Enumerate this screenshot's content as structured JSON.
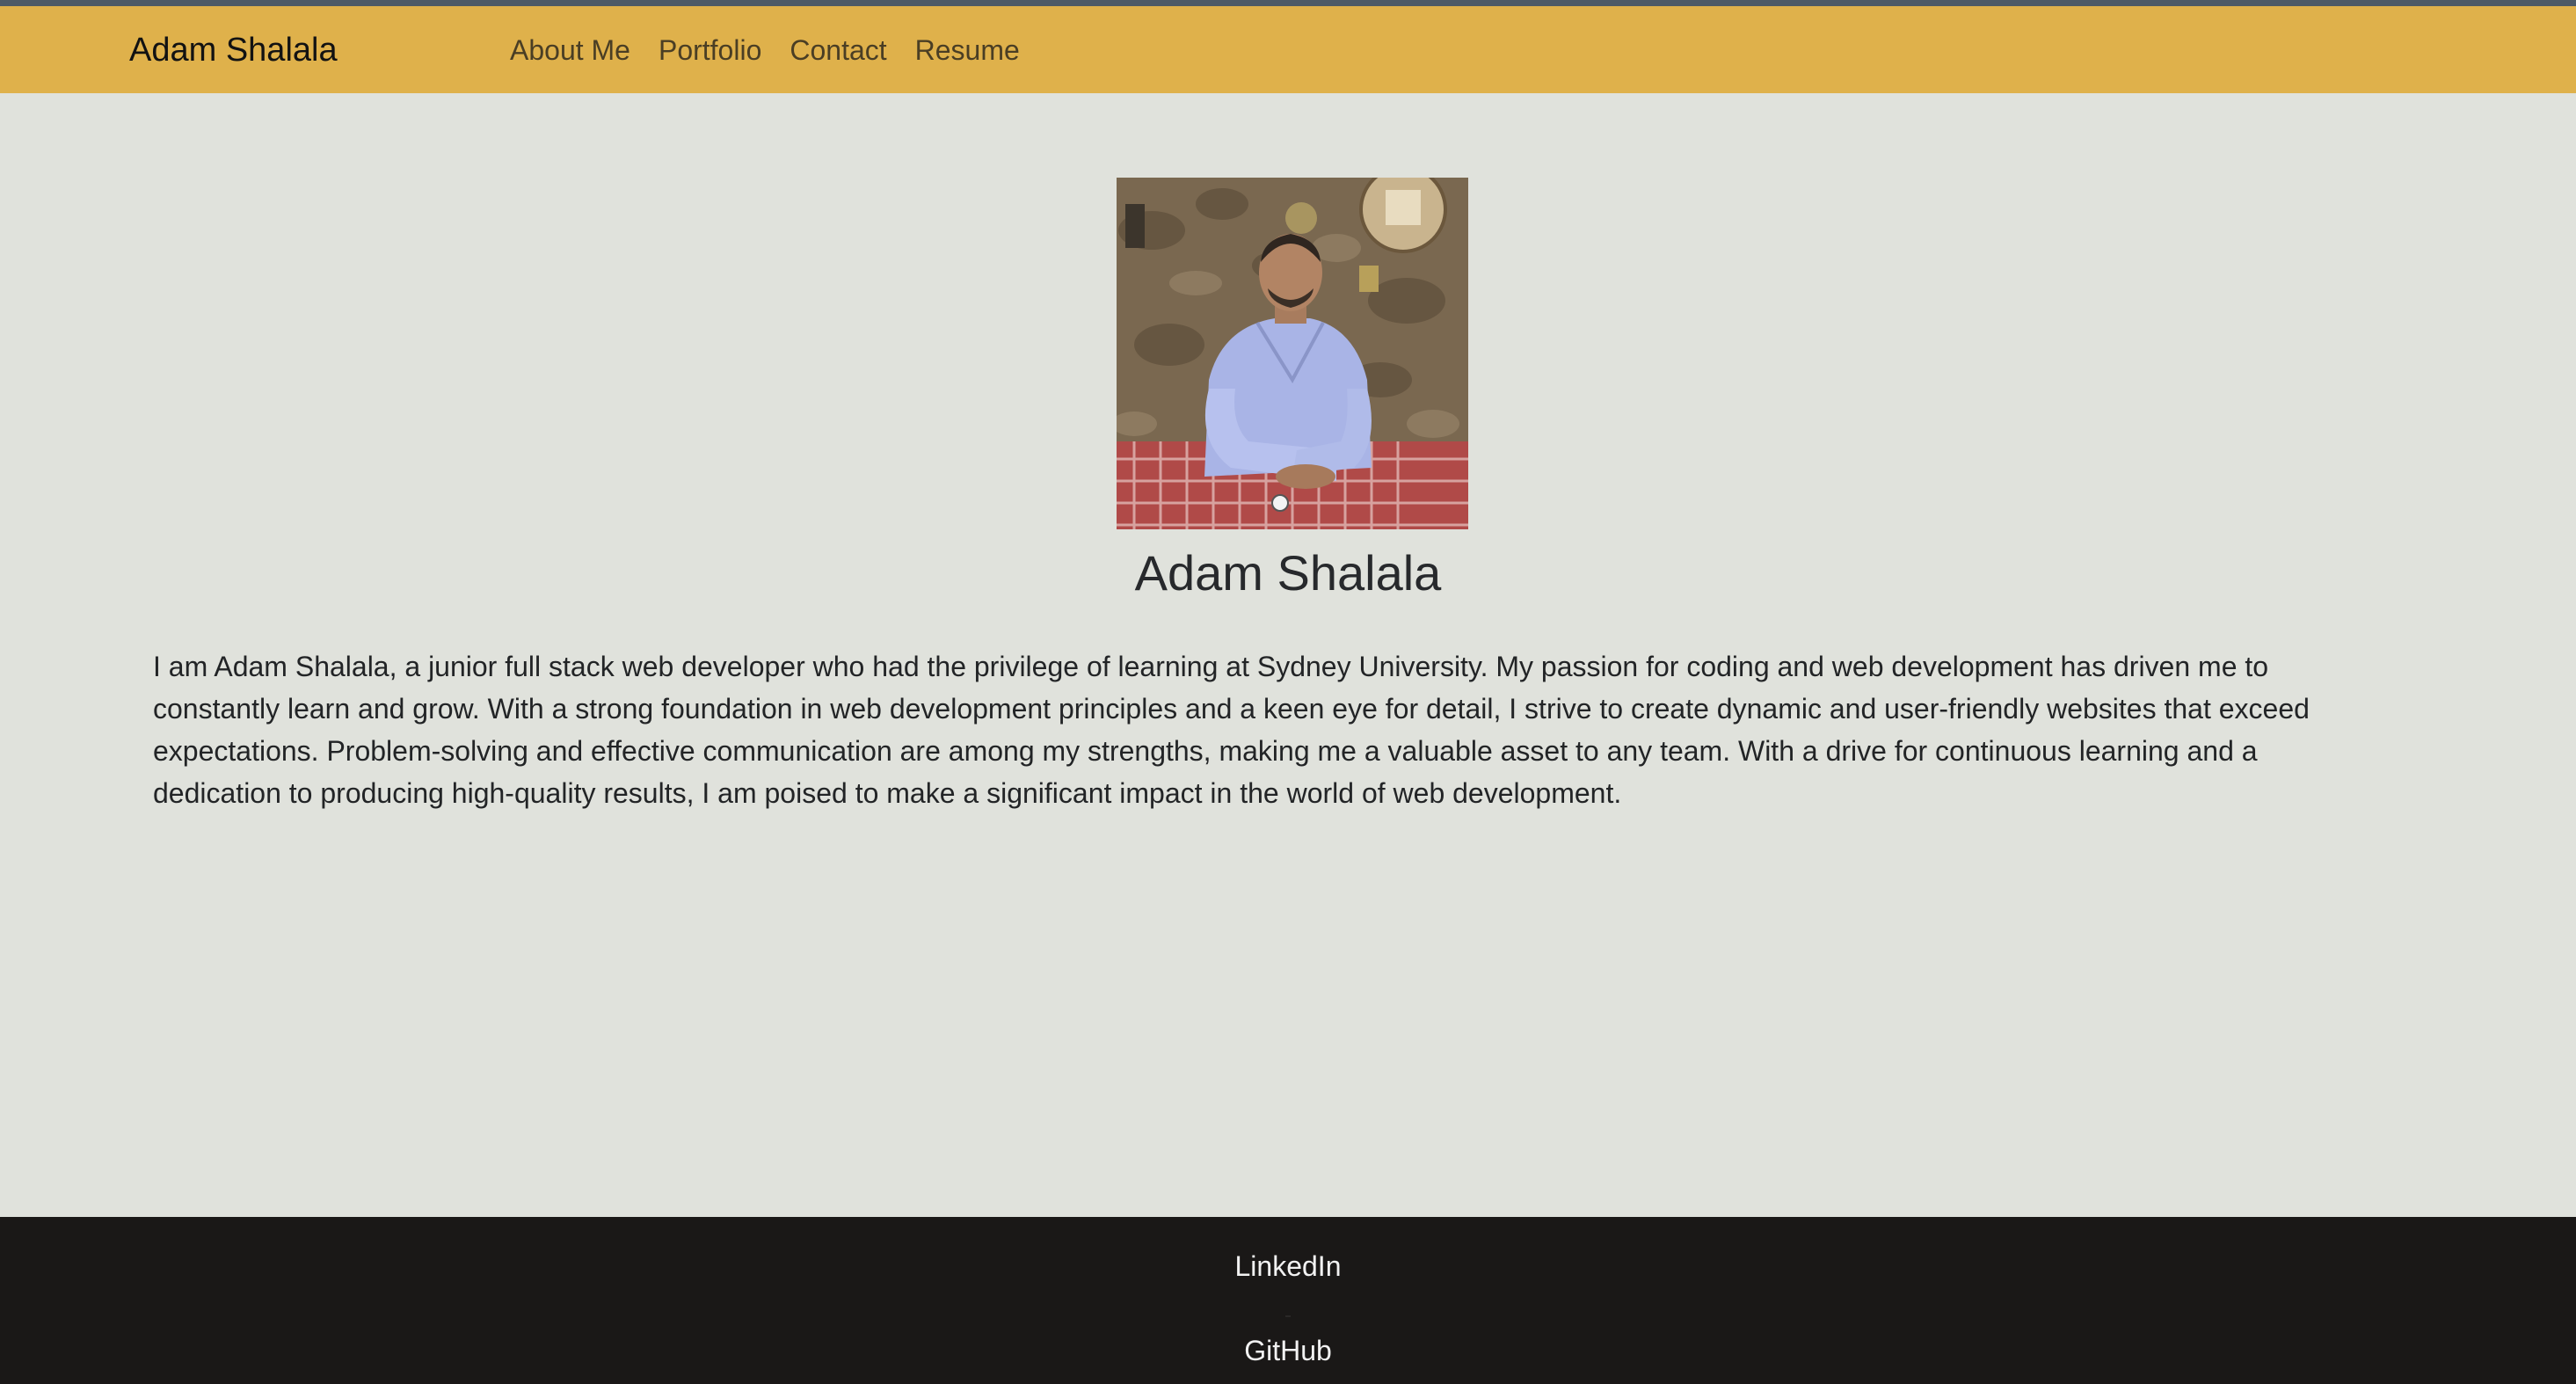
{
  "header": {
    "brand": "Adam Shalala",
    "nav": [
      "About Me",
      "Portfolio",
      "Contact",
      "Resume"
    ]
  },
  "profile": {
    "photo_icon": "profile-photo",
    "name": "Adam Shalala",
    "bio": "I am Adam Shalala, a junior full stack web developer who had the privilege of learning at Sydney University. My passion for coding and web development has driven me to constantly learn and grow. With a strong foundation in web development principles and a keen eye for detail, I strive to create dynamic and user-friendly websites that exceed expectations. Problem-solving and effective communication are among my strengths, making me a valuable asset to any team. With a drive for continuous learning and a dedication to producing high-quality results, I am poised to make a significant impact in the world of web development."
  },
  "footer": {
    "linkedin": "LinkedIn",
    "github": "GitHub"
  },
  "colors": {
    "navbar": "#dfb14b",
    "background": "#e0e2dc",
    "footer": "#1a1817",
    "topstrip": "#4d5a66"
  }
}
